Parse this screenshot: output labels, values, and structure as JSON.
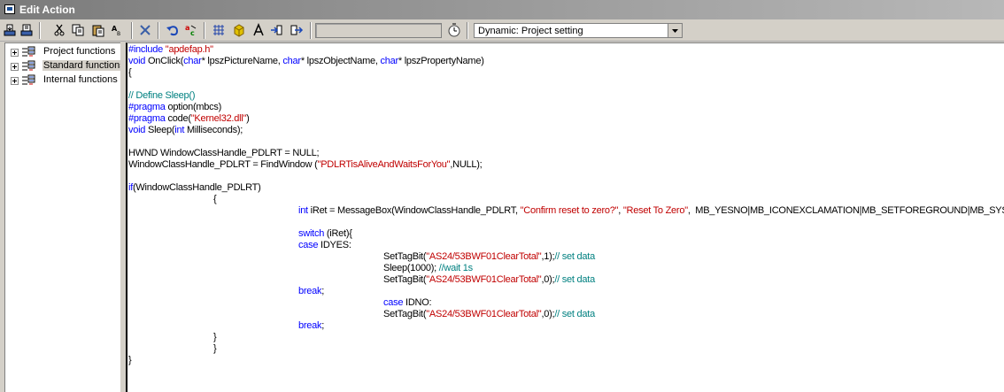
{
  "window": {
    "title": "Edit Action"
  },
  "toolbar": {
    "buttons": [
      {
        "name": "compile-icon"
      },
      {
        "name": "import-icon"
      },
      {
        "name": "cut-icon"
      },
      {
        "name": "copy-icon"
      },
      {
        "name": "paste-icon"
      },
      {
        "name": "format-icon"
      },
      {
        "name": "delete-icon"
      },
      {
        "name": "undo-icon"
      },
      {
        "name": "compile-code-icon"
      },
      {
        "name": "trigger-icon"
      },
      {
        "name": "tag-icon"
      },
      {
        "name": "font-icon"
      },
      {
        "name": "goto-icon"
      },
      {
        "name": "export-icon"
      }
    ],
    "search_value": "",
    "trigger_icon": "clock-icon",
    "dynamic_select": "Dynamic: Project setting"
  },
  "tree": {
    "items": [
      {
        "label": "Project functions",
        "selected": false
      },
      {
        "label": "Standard functions",
        "selected": true
      },
      {
        "label": "Internal functions",
        "selected": false
      }
    ]
  },
  "code": {
    "lines": [
      [
        [
          "kw",
          "#include "
        ],
        [
          "str",
          "\"apdefap.h\""
        ]
      ],
      [
        [
          "kw",
          "void"
        ],
        [
          "t",
          " OnClick("
        ],
        [
          "kw",
          "char"
        ],
        [
          "t",
          "* lpszPictureName, "
        ],
        [
          "kw",
          "char"
        ],
        [
          "t",
          "* lpszObjectName, "
        ],
        [
          "kw",
          "char"
        ],
        [
          "t",
          "* lpszPropertyName)"
        ]
      ],
      [
        [
          "t",
          "{"
        ]
      ],
      [
        [
          "t",
          ""
        ]
      ],
      [
        [
          "cm",
          "// Define Sleep()"
        ]
      ],
      [
        [
          "kw",
          "#pragma"
        ],
        [
          "t",
          " option(mbcs)"
        ]
      ],
      [
        [
          "kw",
          "#pragma"
        ],
        [
          "t",
          " code("
        ],
        [
          "str",
          "\"Kernel32.dll\""
        ],
        [
          "t",
          ")"
        ]
      ],
      [
        [
          "kw",
          "void"
        ],
        [
          "t",
          " Sleep("
        ],
        [
          "kw",
          "int"
        ],
        [
          "t",
          " Milliseconds);"
        ]
      ],
      [
        [
          "t",
          ""
        ]
      ],
      [
        [
          "t",
          "HWND WindowClassHandle_PDLRT = NULL;"
        ]
      ],
      [
        [
          "t",
          "WindowClassHandle_PDLRT = FindWindow ("
        ],
        [
          "str",
          "\"PDLRTisAliveAndWaitsForYou\""
        ],
        [
          "t",
          ",NULL);"
        ]
      ],
      [
        [
          "t",
          ""
        ]
      ],
      [
        [
          "kw",
          "if"
        ],
        [
          "t",
          "(WindowClassHandle_PDLRT)"
        ]
      ],
      [
        [
          "t",
          "\t\t{"
        ]
      ],
      [
        [
          "t",
          "\t\t\t\t"
        ],
        [
          "kw",
          "int"
        ],
        [
          "t",
          " iRet = MessageBox(WindowClassHandle_PDLRT, "
        ],
        [
          "str",
          "\"Confirm reset to zero?\""
        ],
        [
          "t",
          ", "
        ],
        [
          "str",
          "\"Reset To Zero\""
        ],
        [
          "t",
          ",  MB_YESNO|MB_ICONEXCLAMATION|MB_SETFOREGROUND|MB_SYSTEMMODAL);"
        ]
      ],
      [
        [
          "t",
          ""
        ]
      ],
      [
        [
          "t",
          "\t\t\t\t"
        ],
        [
          "kw",
          "switch"
        ],
        [
          "t",
          " (iRet){"
        ]
      ],
      [
        [
          "t",
          "\t\t\t\t"
        ],
        [
          "kw",
          "case"
        ],
        [
          "t",
          " IDYES:"
        ]
      ],
      [
        [
          "t",
          "\t\t\t\t\t\tSetTagBit("
        ],
        [
          "str",
          "\"AS24/53BWF01ClearTotal\""
        ],
        [
          "t",
          ",1);"
        ],
        [
          "cm",
          "// set data"
        ]
      ],
      [
        [
          "t",
          "\t\t\t\t\t\tSleep(1000); "
        ],
        [
          "cm",
          "//wait 1s"
        ]
      ],
      [
        [
          "t",
          "\t\t\t\t\t\tSetTagBit("
        ],
        [
          "str",
          "\"AS24/53BWF01ClearTotal\""
        ],
        [
          "t",
          ",0);"
        ],
        [
          "cm",
          "// set data"
        ]
      ],
      [
        [
          "t",
          "\t\t\t\t"
        ],
        [
          "kw",
          "break"
        ],
        [
          "t",
          ";"
        ]
      ],
      [
        [
          "t",
          "\t\t\t\t\t\t"
        ],
        [
          "kw",
          "case"
        ],
        [
          "t",
          " IDNO:"
        ]
      ],
      [
        [
          "t",
          "\t\t\t\t\t\tSetTagBit("
        ],
        [
          "str",
          "\"AS24/53BWF01ClearTotal\""
        ],
        [
          "t",
          ",0);"
        ],
        [
          "cm",
          "// set data"
        ]
      ],
      [
        [
          "t",
          "\t\t\t\t"
        ],
        [
          "kw",
          "break"
        ],
        [
          "t",
          ";"
        ]
      ],
      [
        [
          "t",
          "\t\t}"
        ]
      ],
      [
        [
          "t",
          "\t\t}"
        ]
      ],
      [
        [
          "t",
          "}"
        ]
      ]
    ]
  }
}
